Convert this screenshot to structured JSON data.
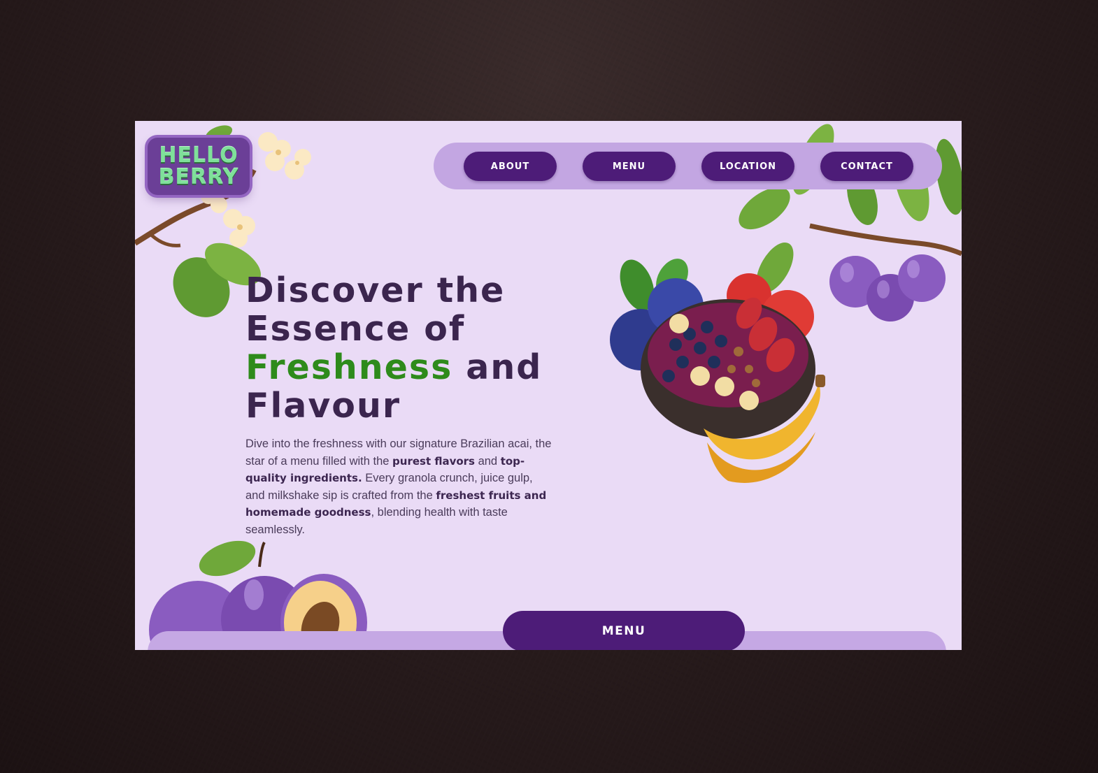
{
  "brand": {
    "logo_line1": "HELLO",
    "logo_line2": "BERRY"
  },
  "nav": {
    "items": [
      {
        "label": "ABOUT"
      },
      {
        "label": "MENU"
      },
      {
        "label": "LOCATION"
      },
      {
        "label": "CONTACT"
      }
    ]
  },
  "hero": {
    "title_part1": "Discover the Essence of",
    "title_accent": "Freshness",
    "title_part2": "and Flavour",
    "body": {
      "t1": "Dive into the freshness with our signature Brazilian acai, the star of a menu filled with the ",
      "b1": "purest flavors",
      "t2": " and ",
      "b2": "top-quality ingredients.",
      "t3": " Every granola crunch, juice gulp, and milkshake sip is crafted from the ",
      "b3": "freshest fruits and homemade goodness",
      "t4": ", blending health with taste seamlessly."
    }
  },
  "cta": {
    "label": "MENU"
  },
  "colors": {
    "page_bg": "#eadbf6",
    "button": "#4d1c78",
    "nav_pill": "#c3a6e2",
    "accent_green": "#2e8b1b",
    "heading": "#3b254e"
  },
  "icons": [
    "logo-badge",
    "blossom-branch-icon",
    "plum-branch-icon",
    "acai-bowl-illustration",
    "plum-cluster-icon"
  ]
}
